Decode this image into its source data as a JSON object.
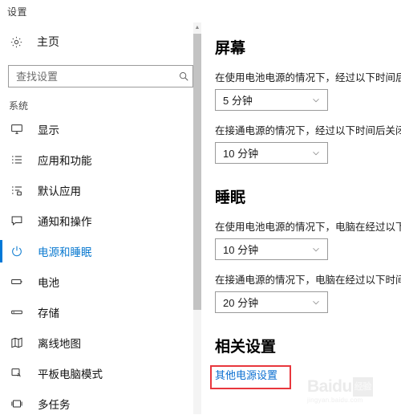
{
  "window": {
    "title": "设置"
  },
  "sidebar": {
    "home": {
      "label": "主页",
      "icon": "gear-icon"
    },
    "search": {
      "placeholder": "查找设置",
      "value": "",
      "icon": "search-icon"
    },
    "group_title": "系统",
    "items": [
      {
        "label": "显示",
        "icon": "monitor-icon",
        "active": false
      },
      {
        "label": "应用和功能",
        "icon": "app-list-icon",
        "active": false
      },
      {
        "label": "默认应用",
        "icon": "default-app-icon",
        "active": false
      },
      {
        "label": "通知和操作",
        "icon": "notification-icon",
        "active": false
      },
      {
        "label": "电源和睡眠",
        "icon": "power-icon",
        "active": true
      },
      {
        "label": "电池",
        "icon": "battery-icon",
        "active": false
      },
      {
        "label": "存储",
        "icon": "storage-icon",
        "active": false
      },
      {
        "label": "离线地图",
        "icon": "map-icon",
        "active": false
      },
      {
        "label": "平板电脑模式",
        "icon": "tablet-icon",
        "active": false
      },
      {
        "label": "多任务",
        "icon": "multitask-icon",
        "active": false
      }
    ],
    "scrollbar": {
      "up_arrow": "▲"
    }
  },
  "content": {
    "screen": {
      "heading": "屏幕",
      "battery_label": "在使用电池电源的情况下，经过以下时间后关闭",
      "battery_value": "5 分钟",
      "plugged_label": "在接通电源的情况下，经过以下时间后关闭",
      "plugged_value": "10 分钟"
    },
    "sleep": {
      "heading": "睡眠",
      "battery_label": "在使用电池电源的情况下，电脑在经过以下时间后进入睡眠状态",
      "battery_value": "10 分钟",
      "plugged_label": "在接通电源的情况下，电脑在经过以下时间后进入睡眠状态",
      "plugged_value": "20 分钟"
    },
    "related": {
      "heading": "相关设置",
      "link_label": "其他电源设置"
    }
  },
  "annotation": {
    "highlight_color": "#e8373d"
  },
  "watermark": {
    "main": "Baidu",
    "cn": "经验",
    "sub": "jingyan.baidu.com"
  },
  "colors": {
    "accent": "#0078d7",
    "link": "#0b6fd1",
    "text": "#111111"
  }
}
